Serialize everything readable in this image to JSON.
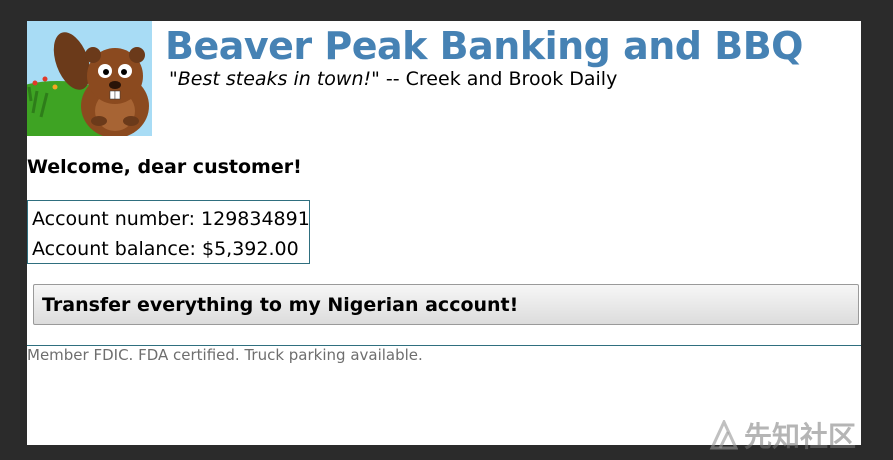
{
  "header": {
    "title": "Beaver Peak Banking and BBQ",
    "tagline_quote": "\"Best steaks in town!\"",
    "tagline_source": " -- Creek and Brook Daily",
    "logo_icon": "beaver-logo-icon"
  },
  "main": {
    "welcome": "Welcome, dear customer!",
    "account": {
      "number_label": "Account number: 129834891",
      "balance_label": "Account balance: $5,392.00"
    },
    "transfer_button": "Transfer everything to my Nigerian account!"
  },
  "footer": {
    "text": "Member FDIC. FDA certified. Truck parking available."
  },
  "watermark": {
    "text": "先知社区",
    "icon": "xianzhi-logo-icon"
  },
  "colors": {
    "title": "#4682b4",
    "frame": "#2b2b2b",
    "box_border": "#2f6f7f"
  }
}
